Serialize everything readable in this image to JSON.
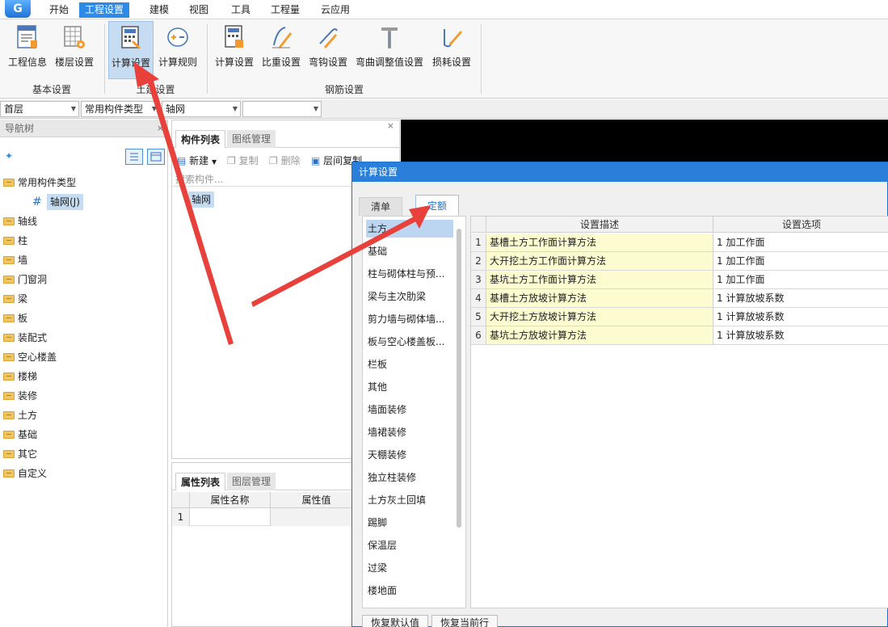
{
  "app": {
    "logo_text": "G"
  },
  "menu": [
    "开始",
    "工程设置",
    "建模",
    "视图",
    "工具",
    "工程量",
    "云应用"
  ],
  "ribbon": {
    "basic": {
      "group": "基本设置",
      "items": [
        "工程信息",
        "楼层设置"
      ]
    },
    "civil": {
      "group": "土建设置",
      "items": [
        "计算设置",
        "计算规则"
      ]
    },
    "rebar": {
      "group": "钢筋设置",
      "items": [
        "计算设置",
        "比重设置",
        "弯钩设置",
        "弯曲调整值设置",
        "损耗设置"
      ]
    }
  },
  "dropdowns": [
    "首层",
    "常用构件类型",
    "轴网",
    ""
  ],
  "nav": {
    "title": "导航树",
    "close": "×",
    "root": "常用构件类型",
    "child": "轴网(J)",
    "items": [
      "轴线",
      "柱",
      "墙",
      "门窗洞",
      "梁",
      "板",
      "装配式",
      "空心楼盖",
      "楼梯",
      "装修",
      "土方",
      "基础",
      "其它",
      "自定义"
    ]
  },
  "components": {
    "tabs": [
      "构件列表",
      "图纸管理"
    ],
    "close": "×",
    "toolbar": {
      "new": "新建",
      "copy": "复制",
      "delete": "删除",
      "floor_copy": "层间复制"
    },
    "search_placeholder": "搜索构件...",
    "item": "轴网"
  },
  "properties": {
    "tabs": [
      "属性列表",
      "图层管理"
    ],
    "col_name": "属性名称",
    "col_value": "属性值",
    "row1": "1"
  },
  "dialog": {
    "title": "计算设置",
    "tabs": [
      "清单",
      "定额"
    ],
    "list": [
      "土方",
      "基础",
      "柱与砌体柱与预...",
      "梁与主次肋梁",
      "剪力墙与砌体墙...",
      "板与空心楼盖板...",
      "栏板",
      "其他",
      "墙面装修",
      "墙裙装修",
      "天棚装修",
      "独立柱装修",
      "土方灰土回填",
      "踢脚",
      "保温层",
      "过梁",
      "楼地面"
    ],
    "headers": {
      "desc": "设置描述",
      "option": "设置选项"
    },
    "rows": [
      {
        "num": "1",
        "desc": "基槽土方工作面计算方法",
        "option": "1 加工作面"
      },
      {
        "num": "2",
        "desc": "大开挖土方工作面计算方法",
        "option": "1 加工作面"
      },
      {
        "num": "3",
        "desc": "基坑土方工作面计算方法",
        "option": "1 加工作面"
      },
      {
        "num": "4",
        "desc": "基槽土方放坡计算方法",
        "option": "1 计算放坡系数"
      },
      {
        "num": "5",
        "desc": "大开挖土方放坡计算方法",
        "option": "1 计算放坡系数"
      },
      {
        "num": "6",
        "desc": "基坑土方放坡计算方法",
        "option": "1 计算放坡系数"
      }
    ],
    "buttons": [
      "恢复默认值",
      "恢复当前行"
    ]
  },
  "colors": {
    "accent": "#2a7fdb",
    "highlight": "#fdfbd0",
    "selection": "#bcd6f1",
    "arrow": "#e8413c"
  }
}
